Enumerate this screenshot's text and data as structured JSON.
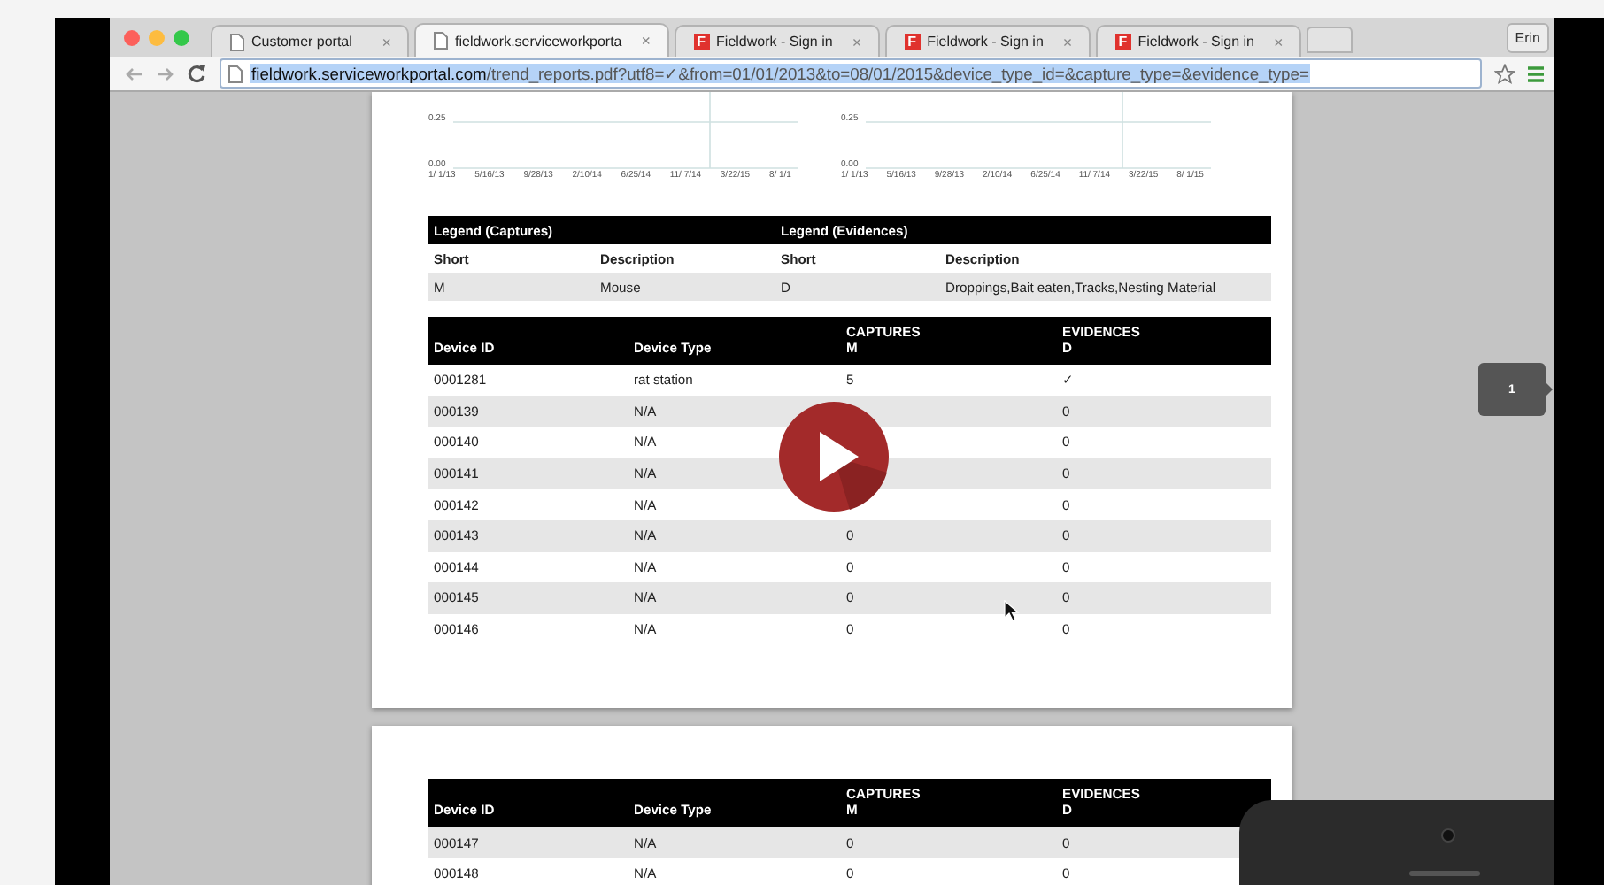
{
  "browser": {
    "tabs": [
      {
        "title": "Customer portal",
        "icon": {
          "kind": "document"
        },
        "selected": false,
        "close": "×"
      },
      {
        "title": "fieldwork.serviceworkporta",
        "icon": {
          "kind": "document"
        },
        "selected": true,
        "close": "×"
      },
      {
        "title": "Fieldwork - Sign in",
        "icon": {
          "kind": "brand",
          "letter": "F"
        },
        "selected": false,
        "close": "×"
      },
      {
        "title": "Fieldwork - Sign in",
        "icon": {
          "kind": "brand",
          "letter": "F"
        },
        "selected": false,
        "close": "×"
      },
      {
        "title": "Fieldwork - Sign in",
        "icon": {
          "kind": "brand",
          "letter": "F"
        },
        "selected": false,
        "close": "×"
      }
    ],
    "profile": "Erin",
    "address": {
      "host": "fieldwork.serviceworkportal.com",
      "path": "/trend_reports.pdf?utf8=✓&from=01/01/2013&to=08/01/2015&device_type_id=&capture_type=&evidence_type=",
      "selected": true
    }
  },
  "pages": [
    {
      "charts": [
        {
          "yticks": [
            "0.25",
            "0.00"
          ],
          "xticks": [
            "1/ 1/13",
            "5/16/13",
            "9/28/13",
            "2/10/14",
            "6/25/14",
            "11/ 7/14",
            "3/22/15",
            "8/ 1/1"
          ]
        },
        {
          "yticks": [
            "0.25",
            "0.00"
          ],
          "xticks": [
            "1/ 1/13",
            "5/16/13",
            "9/28/13",
            "2/10/14",
            "6/25/14",
            "11/ 7/14",
            "3/22/15",
            "8/ 1/15"
          ]
        }
      ],
      "legend": {
        "groups": [
          "Legend (Captures)",
          "Legend (Evidences)"
        ],
        "columns": [
          "Short",
          "Description",
          "Short",
          "Description"
        ],
        "rows": [
          [
            "M",
            "Mouse",
            "D",
            "Droppings,Bait eaten,Tracks,Nesting Material"
          ]
        ]
      },
      "device_table": {
        "columns": [
          {
            "title": "Device ID"
          },
          {
            "title": "Device Type"
          },
          {
            "title": "CAPTURES",
            "subtitle": "M"
          },
          {
            "title": "EVIDENCES",
            "subtitle": "D"
          }
        ],
        "rows": [
          {
            "device_id": "0001281",
            "device_type": "rat station",
            "captures": "5",
            "evidences": "✓"
          },
          {
            "device_id": "000139",
            "device_type": "N/A",
            "evidences": "0"
          },
          {
            "device_id": "000140",
            "device_type": "N/A",
            "evidences": "0"
          },
          {
            "device_id": "000141",
            "device_type": "N/A",
            "evidences": "0"
          },
          {
            "device_id": "000142",
            "device_type": "N/A",
            "evidences": "0"
          },
          {
            "device_id": "000143",
            "device_type": "N/A",
            "captures": "0",
            "evidences": "0"
          },
          {
            "device_id": "000144",
            "device_type": "N/A",
            "captures": "0",
            "evidences": "0"
          },
          {
            "device_id": "000145",
            "device_type": "N/A",
            "captures": "0",
            "evidences": "0"
          },
          {
            "device_id": "000146",
            "device_type": "N/A",
            "captures": "0",
            "evidences": "0"
          }
        ]
      }
    },
    {
      "device_table": {
        "columns": [
          {
            "title": "Device ID"
          },
          {
            "title": "Device Type"
          },
          {
            "title": "CAPTURES",
            "subtitle": "M"
          },
          {
            "title": "EVIDENCES",
            "subtitle": "D"
          }
        ],
        "rows": [
          {
            "device_id": "000147",
            "device_type": "N/A",
            "captures": "0",
            "evidences": "0"
          },
          {
            "device_id": "000148",
            "device_type": "N/A",
            "captures": "0",
            "evidences": "0"
          }
        ]
      }
    }
  ],
  "page_indicator": "1"
}
